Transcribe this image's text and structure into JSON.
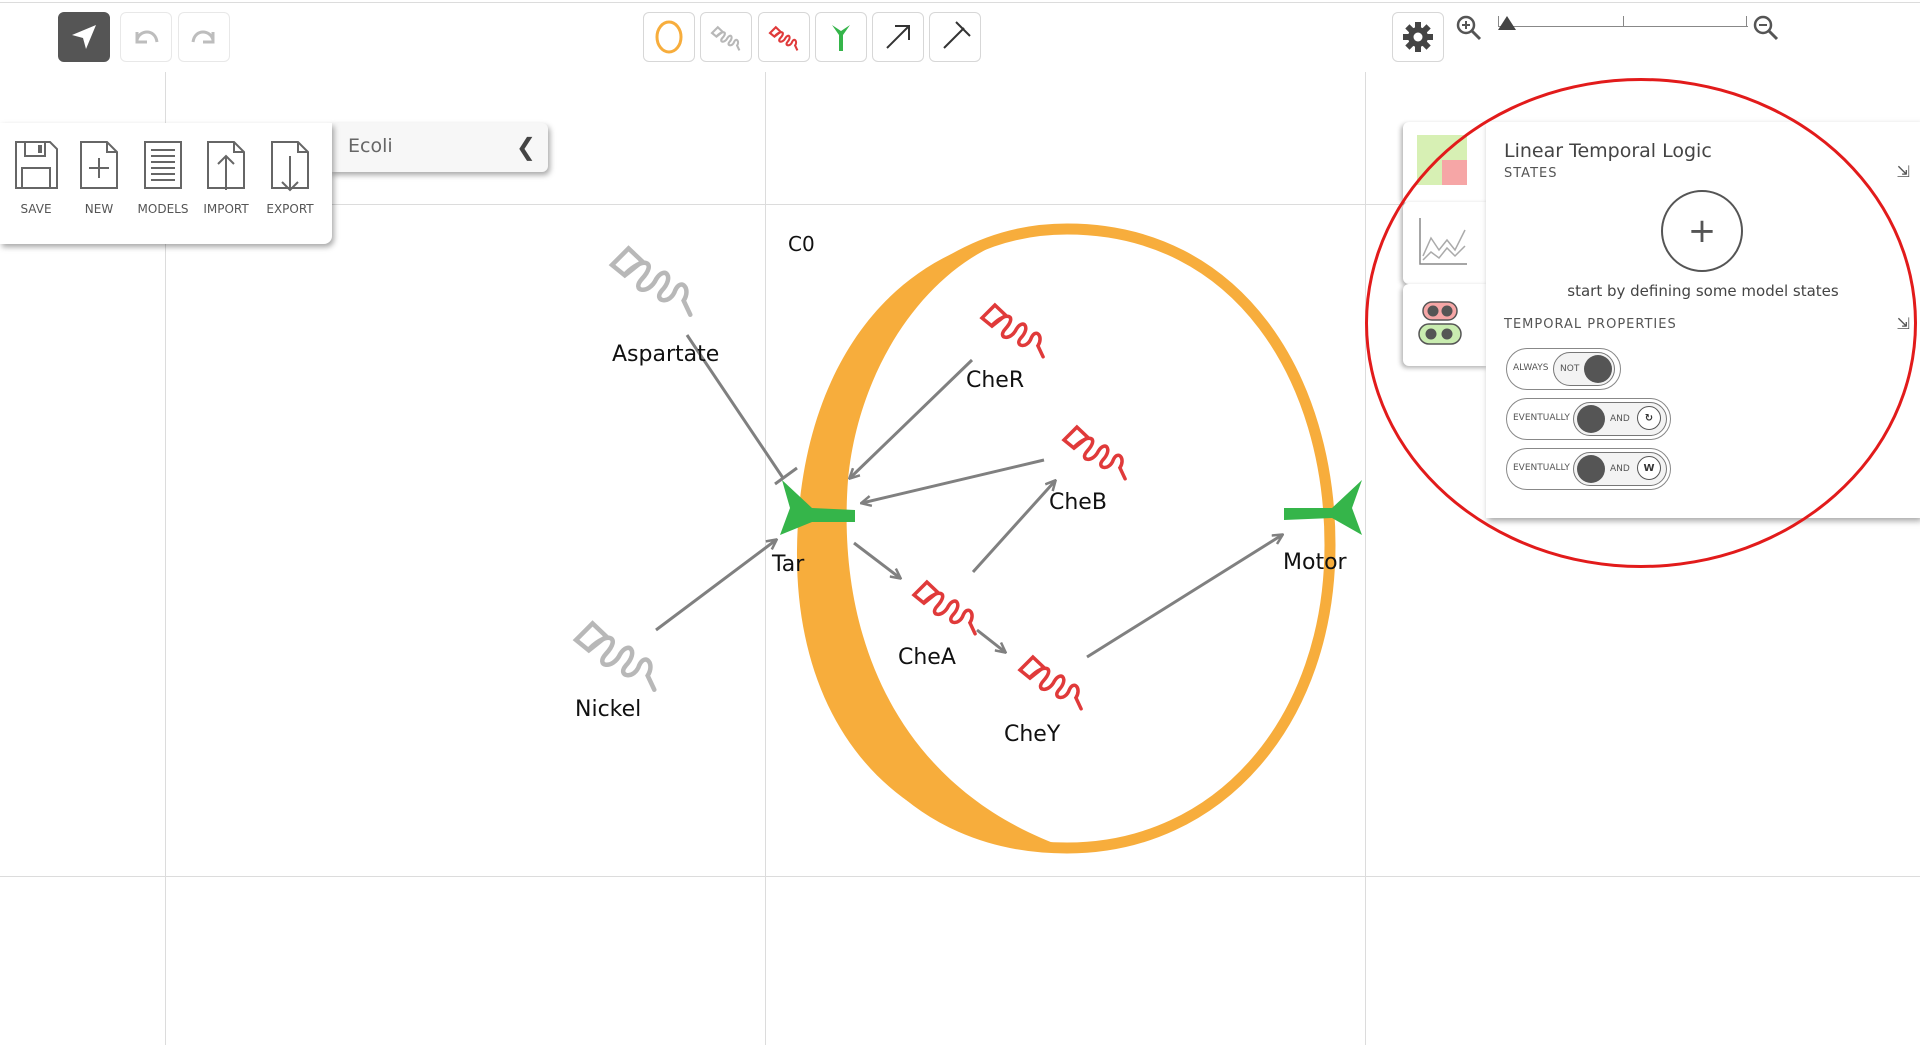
{
  "toolbar": {
    "select_tool": "select-arrow-icon",
    "undo": "undo-icon",
    "redo": "redo-icon",
    "cell_tool": "cell-icon",
    "variable_tool": "variable-icon",
    "constant_tool": "constant-icon",
    "receptor_tool": "receptor-icon",
    "activator_tool": "activating-arrow-icon",
    "inhibitor_tool": "inhibiting-arrow-icon",
    "settings": "gear-icon",
    "zoom_in": "zoom-in-icon",
    "zoom_out": "zoom-out-icon"
  },
  "file_panel": {
    "model_name": "Ecoli",
    "items": [
      {
        "label": "SAVE",
        "icon": "save-icon"
      },
      {
        "label": "NEW",
        "icon": "new-icon"
      },
      {
        "label": "MODELS",
        "icon": "models-icon"
      },
      {
        "label": "IMPORT",
        "icon": "import-icon"
      },
      {
        "label": "EXPORT",
        "icon": "export-icon"
      }
    ]
  },
  "model": {
    "cell_name": "C0",
    "nodes": {
      "aspartate": "Aspartate",
      "nickel": "Nickel",
      "tar": "Tar",
      "motor": "Motor",
      "cher": "CheR",
      "cheb": "CheB",
      "chea": "CheA",
      "chey": "CheY"
    }
  },
  "ltl_panel": {
    "title": "Linear Temporal Logic",
    "states_heading": "STATES",
    "add_state_symbol": "+",
    "states_hint": "start by defining some model states",
    "temporal_heading": "TEMPORAL PROPERTIES",
    "properties": [
      {
        "outer": "ALWAYS",
        "inner": "NOT",
        "icon": ""
      },
      {
        "outer": "EVENTUALLY",
        "inner": "AND",
        "icon": "loop-icon"
      },
      {
        "outer": "EVENTUALLY",
        "inner": "AND",
        "icon": "oscillation-icon",
        "icon_text": "W"
      }
    ]
  },
  "colors": {
    "cell": "#f7ad3c",
    "variable": "#e03a3a",
    "constant": "#b8b8b8",
    "receptor": "#35b54a",
    "arrow": "#808080",
    "highlight": "#e21b1b"
  }
}
